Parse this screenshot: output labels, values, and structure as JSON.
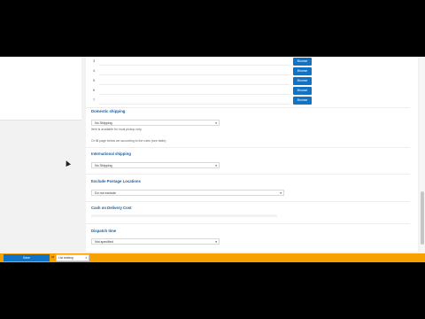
{
  "media_rows": [
    {
      "index": "3",
      "button_label": "Browse"
    },
    {
      "index": "4",
      "button_label": "Browse"
    },
    {
      "index": "5",
      "button_label": "Browse"
    },
    {
      "index": "6",
      "button_label": "Browse"
    },
    {
      "index": "7",
      "button_label": "Browse"
    }
  ],
  "domestic_shipping": {
    "title": "Domestic shipping",
    "select_value": "No Shipping",
    "help_line1": "Item is available for local pickup only.",
    "help_line2": "Or fill page below we according to the rules (see table)."
  },
  "international_shipping": {
    "title": "International shipping",
    "select_value": "No Shipping"
  },
  "exclude_postage": {
    "title": "Exclude Postage Locations",
    "select_value": "Do not exclude"
  },
  "cash_on_delivery": {
    "title": "Cash on Delivery Cost"
  },
  "dispatch_time": {
    "title": "Dispatch time",
    "select_value": "Not specified"
  },
  "bottom_bar": {
    "save_label": "Save",
    "or_label": "or",
    "select_value": "List existing"
  },
  "colors": {
    "accent_blue": "#1173c6",
    "bottom_bar_orange": "#f5a100",
    "section_title_blue": "#1d5fa3"
  }
}
